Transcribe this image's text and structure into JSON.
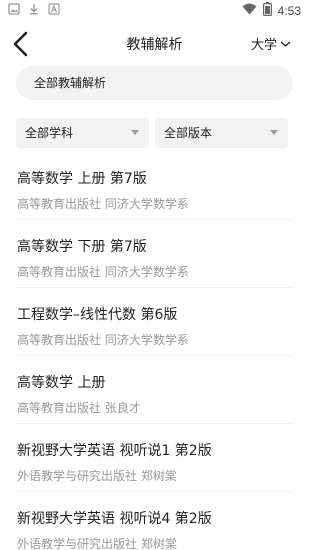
{
  "status_bar": {
    "time": "4:53",
    "left_icons": [
      "image-icon",
      "download-icon",
      "a-box-icon"
    ],
    "right_icons": [
      "wifi-icon",
      "battery-icon"
    ]
  },
  "header": {
    "title": "教辅解析",
    "level_label": "大学"
  },
  "search": {
    "label": "全部教辅解析"
  },
  "filters": {
    "subject": "全部学科",
    "edition": "全部版本"
  },
  "books": [
    {
      "name": "高等数学 上册 第7版",
      "meta": "高等教育出版社 同济大学数学系"
    },
    {
      "name": "高等数学 下册 第7版",
      "meta": "高等教育出版社 同济大学数学系"
    },
    {
      "name": "工程数学–线性代数 第6版",
      "meta": "高等教育出版社 同济大学数学系"
    },
    {
      "name": "高等数学 上册",
      "meta": "高等教育出版社 张良才"
    },
    {
      "name": "新视野大学英语 视听说1 第2版",
      "meta": "外语教学与研究出版社 郑树棠"
    },
    {
      "name": "新视野大学英语 视听说4 第2版",
      "meta": "外语教学与研究出版社 郑树棠"
    }
  ],
  "colors": {
    "background": "#ffffff",
    "pill": "#f2f2f2",
    "text": "#222222",
    "secondary_text": "#999999"
  }
}
